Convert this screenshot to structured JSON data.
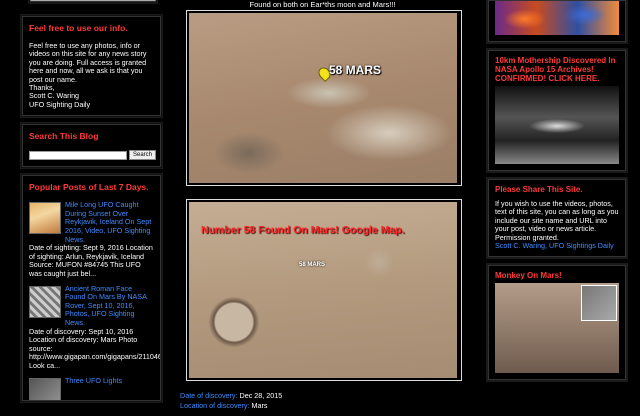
{
  "left": {
    "info": {
      "title": "Feel free to use our info.",
      "text": "Feel free to use any photos, info or videos on this site for any news story you are doing. Full access is granted here and now, all we ask is that you post our name.",
      "thanks": "Thanks,",
      "sig1": "Scott C. Waring",
      "sig2": "UFO Sighting Daily"
    },
    "search": {
      "title": "Search This Blog",
      "button": "Search"
    },
    "popular": {
      "title": "Popular Posts of Last 7 Days.",
      "posts": [
        {
          "title": "Mile Long UFO Caught During Sunset Over Reykjavik, Iceland On Sept 2016, Video, UFO Sighting News.",
          "desc": "Date of sighting: Sept 9, 2016 Location of sighting: Arlun, Reykjavik, Iceland Source: MUFON #84745 This UFO was caught just bel..."
        },
        {
          "title": "Ancient Roman Face Found On Mars By NASA Rover, Sept 10, 2016, Photos, UFO Sighting News.",
          "desc": "Date of discovery: Sept 10, 2016 Location of discovery: Mars Photo source: http://www.gigapan.com/gigapans/211046 Look ca..."
        },
        {
          "title": "Three UFO Lights"
        }
      ]
    }
  },
  "main": {
    "caption_top": "Found on both on Ear*ths moon and Mars!!!",
    "img1_label": "58 MARS",
    "img2_label": "Number 58 Found On Mars! Google Map.",
    "img2_sub": "58 MARS",
    "meta": [
      {
        "k": "Date of discovery:",
        "v": "Dec 28, 2015"
      },
      {
        "k": "Location of discovery:",
        "v": "Mars"
      }
    ]
  },
  "right": {
    "mothership": {
      "title": "10km Mothership Discovered In NASA Apollo 15 Archives! CONFIRMED! CLICK HERE."
    },
    "share": {
      "title": "Please Share This Site.",
      "text": "If you wish to use the videos, photos, text of this site, you can as long as you include our site name and URL into your post, video or news article. Permission granted.",
      "sig": "Scott C. Waring, UFO Sightings Daily"
    },
    "monkey": {
      "title": "Monkey On Mars!"
    }
  }
}
